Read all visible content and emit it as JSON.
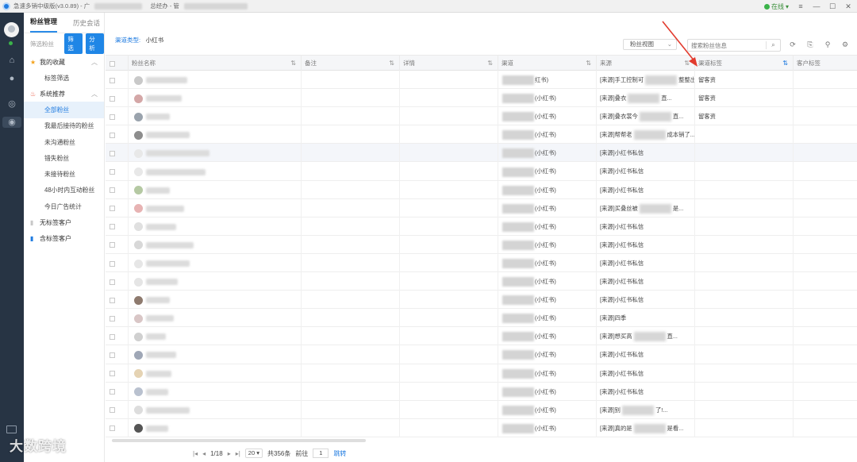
{
  "window": {
    "title_prefix": "急速多销中级版(v3.0.89) - 广",
    "title_middle": "总经办 - 管",
    "status": "在线",
    "controls": [
      "▾",
      "—",
      "☐",
      "✕"
    ]
  },
  "sidebar": {
    "tabs": [
      "粉丝管理",
      "历史会话"
    ],
    "filter_label": "筛选粉丝",
    "filter_btn": "筛选",
    "analyze_btn": "分析",
    "favorites": "我的收藏",
    "tag_filter": "标签筛选",
    "system": "系统推荐",
    "items": [
      "全部粉丝",
      "我最后接待的粉丝",
      "未沟通粉丝",
      "错失粉丝",
      "未接待粉丝",
      "48小时内互动粉丝",
      "今日广告统计"
    ],
    "untagged": "无标签客户",
    "tagged": "含标签客户"
  },
  "main": {
    "channel_key": "渠道类型:",
    "channel_value": "小红书",
    "view_select": "粉丝视图",
    "search_placeholder": "搜索粉丝信息",
    "columns": [
      "粉丝名称",
      "备注",
      "详情",
      "渠道",
      "来源",
      "渠道标签",
      "客户标签"
    ]
  },
  "rows": [
    {
      "chan": "红书)",
      "src_pre": "[来源]手工控制可",
      "src_post": "整整出...",
      "tag": "留客资"
    },
    {
      "chan": "(小红书)",
      "src_pre": "[来源]叠衣",
      "src_post": "直...",
      "tag": "留客资"
    },
    {
      "chan": "(小红书)",
      "src_pre": "[来源]叠衣裳今",
      "src_post": "直...",
      "tag": "留客资"
    },
    {
      "chan": "(小红书)",
      "src_pre": "[来源]帮帮老",
      "src_post": "成本销了...",
      "tag": ""
    },
    {
      "chan": "(小红书)",
      "src_pre": "[来源]小红书私信",
      "src_post": "",
      "tag": ""
    },
    {
      "chan": "(小红书)",
      "src_pre": "[来源]小红书私信",
      "src_post": "",
      "tag": ""
    },
    {
      "chan": "(小红书)",
      "src_pre": "[来源]小红书私信",
      "src_post": "",
      "tag": ""
    },
    {
      "chan": "(小红书)",
      "src_pre": "[来源]买叠丝被",
      "src_post": "是...",
      "tag": ""
    },
    {
      "chan": "(小红书)",
      "src_pre": "[来源]小红书私信",
      "src_post": "",
      "tag": ""
    },
    {
      "chan": "(小红书)",
      "src_pre": "[来源]小红书私信",
      "src_post": "",
      "tag": ""
    },
    {
      "chan": "(小红书)",
      "src_pre": "[来源]小红书私信",
      "src_post": "",
      "tag": ""
    },
    {
      "chan": "(小红书)",
      "src_pre": "[来源]小红书私信",
      "src_post": "",
      "tag": ""
    },
    {
      "chan": "(小红书)",
      "src_pre": "[来源]小红书私信",
      "src_post": "",
      "tag": ""
    },
    {
      "chan": "(小红书)",
      "src_pre": "[来源]四季",
      "src_post": "",
      "tag": ""
    },
    {
      "chan": "(小红书)",
      "src_pre": "[来源]想买高",
      "src_post": "直...",
      "tag": ""
    },
    {
      "chan": "(小红书)",
      "src_pre": "[来源]小红书私信",
      "src_post": "",
      "tag": ""
    },
    {
      "chan": "(小红书)",
      "src_pre": "[来源]小红书私信",
      "src_post": "",
      "tag": ""
    },
    {
      "chan": "(小红书)",
      "src_pre": "[来源]小红书私信",
      "src_post": "",
      "tag": ""
    },
    {
      "chan": "(小红书)",
      "src_pre": "[来源]别",
      "src_post": "了!...",
      "tag": ""
    },
    {
      "chan": "(小红书)",
      "src_pre": "[来源]真的是",
      "src_post": "是看...",
      "tag": ""
    }
  ],
  "pager": {
    "page": "1/18",
    "size": "20",
    "total": "共356条",
    "goto_label": "前往",
    "goto_value": "1",
    "jump": "跳转"
  },
  "watermark": "大数跨境"
}
